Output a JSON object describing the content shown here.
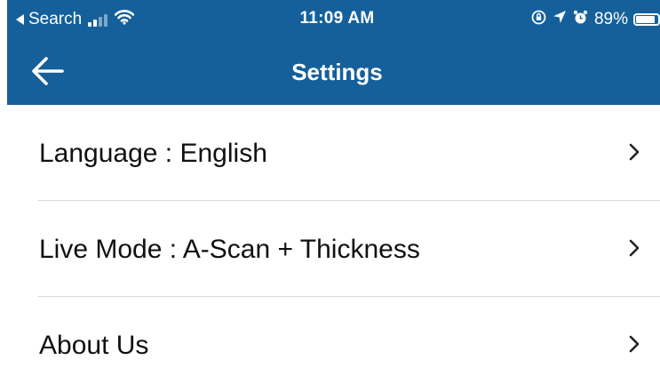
{
  "status_bar": {
    "back_app_label": "Search",
    "time": "11:09 AM",
    "battery_percent": "89%",
    "battery_level": 0.89,
    "icons": [
      "signal-icon",
      "wifi-icon",
      "orientation-lock-icon",
      "location-icon",
      "alarm-icon",
      "battery-icon"
    ]
  },
  "header": {
    "title": "Settings",
    "back_icon": "arrow-left-icon",
    "background_color": "#15609b"
  },
  "settings": {
    "items": [
      {
        "label": "Language : English",
        "icon": "chevron-right-icon"
      },
      {
        "label": "Live Mode : A-Scan + Thickness",
        "icon": "chevron-right-icon"
      },
      {
        "label": "About Us",
        "icon": "chevron-right-icon"
      }
    ]
  }
}
